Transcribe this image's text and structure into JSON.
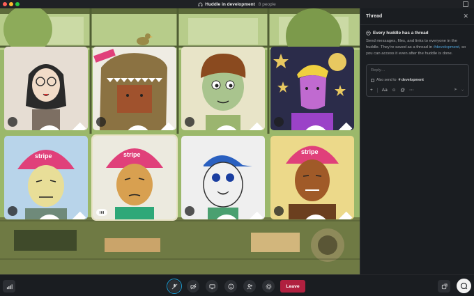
{
  "window": {
    "title": "Huddle in development",
    "people_count": "8 people"
  },
  "panel": {
    "title": "Thread",
    "heading": "Every huddle has a thread",
    "desc_part1": "Send messages, files, and links to everyone in the huddle. They’re saved as a thread in ",
    "channel_link": "#development",
    "desc_part2": ", so you can access it even after the huddle is done.",
    "reply_placeholder": "Reply…",
    "also_send_prefix": "Also send to",
    "also_send_channel": "# development",
    "tool_aa": "Aa"
  },
  "participants": [
    {
      "name": "glasses-person",
      "muted": true
    },
    {
      "name": "dino-costume",
      "muted": true
    },
    {
      "name": "brown-hair-boy",
      "muted": true
    },
    {
      "name": "yellow-hair-purple-face",
      "muted": true
    },
    {
      "name": "pink-hat-blue",
      "muted": true
    },
    {
      "name": "pink-hat-speaking",
      "muted": false,
      "speaking": true
    },
    {
      "name": "blue-cap",
      "muted": true
    },
    {
      "name": "pink-hat-yellow",
      "muted": true
    }
  ],
  "controls": {
    "leave_label": "Leave"
  },
  "colors": {
    "accent_blue": "#1d9bd1",
    "leave_red": "#b0203f",
    "link_blue": "#4fa3d8"
  }
}
